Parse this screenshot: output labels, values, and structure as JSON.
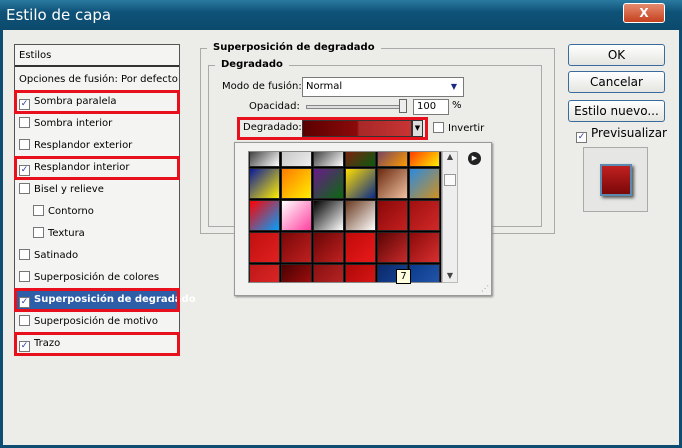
{
  "window": {
    "title": "Estilo de capa",
    "close": "X"
  },
  "styles_list": {
    "header": "Estilos",
    "items": [
      {
        "label": "Opciones de fusión: Por defecto",
        "checkbox": false,
        "checked": false
      },
      {
        "label": "Sombra paralela",
        "checkbox": true,
        "checked": true,
        "highlighted": true
      },
      {
        "label": "Sombra interior",
        "checkbox": true,
        "checked": false
      },
      {
        "label": "Resplandor exterior",
        "checkbox": true,
        "checked": false
      },
      {
        "label": "Resplandor interior",
        "checkbox": true,
        "checked": true,
        "highlighted": true
      },
      {
        "label": "Bisel y relieve",
        "checkbox": true,
        "checked": false
      },
      {
        "label": "Contorno",
        "checkbox": true,
        "checked": false,
        "sub": true
      },
      {
        "label": "Textura",
        "checkbox": true,
        "checked": false,
        "sub": true
      },
      {
        "label": "Satinado",
        "checkbox": true,
        "checked": false
      },
      {
        "label": "Superposición de colores",
        "checkbox": true,
        "checked": false
      },
      {
        "label": "Superposición de degradado",
        "checkbox": true,
        "checked": true,
        "selected": true,
        "highlighted": true
      },
      {
        "label": "Superposición de motivo",
        "checkbox": true,
        "checked": false
      },
      {
        "label": "Trazo",
        "checkbox": true,
        "checked": true,
        "highlighted": true
      }
    ]
  },
  "panel": {
    "title": "Superposición de degradado",
    "subtitle": "Degradado",
    "blend_mode_label": "Modo de fusión:",
    "blend_mode": "Normal",
    "opacity_label": "Opacidad:",
    "opacity": "100",
    "opacity_unit": "%",
    "gradient_label": "Degradado:",
    "invert_label": "Invertir",
    "tooltip": "7"
  },
  "buttons": {
    "ok": "OK",
    "cancel": "Cancelar",
    "new_style": "Estilo nuevo...",
    "preview": "Previsualizar"
  },
  "colors": {
    "highlight": "#e8101c",
    "selected": "#2e5ea8",
    "gradient_start": "#5a0000",
    "gradient_end": "#c83434"
  },
  "swatches": [
    [
      "#000",
      "#fff"
    ],
    [
      "#bbb",
      "#eee"
    ],
    [
      "#000",
      "#fff"
    ],
    [
      "#a01010",
      "#0a5a10"
    ],
    [
      "#4a2a80",
      "#ff9a00"
    ],
    [
      "#ff0000",
      "#ffee00"
    ],
    [
      "#0a1a9a",
      "#ffee00"
    ],
    [
      "#ff7a00",
      "#ffee00"
    ],
    [
      "#6a1a8a",
      "#0a6a10"
    ],
    [
      "#ffdd00",
      "#0a2a8a"
    ],
    [
      "#6a2a10",
      "#f0c0a0"
    ],
    [
      "#2a8ae0",
      "#d09020"
    ],
    [
      "#ff0000",
      "#00a0ff"
    ],
    [
      "#fff",
      "#ff40a0"
    ],
    [
      "#000",
      "#fff"
    ],
    [
      "#6a3a20",
      "#fff"
    ],
    [
      "#8a0808",
      "#c42020"
    ],
    [
      "#a01010",
      "#d02828"
    ],
    [
      "#c01010",
      "#e02020"
    ],
    [
      "#7a0808",
      "#c02020"
    ],
    [
      "#6a0606",
      "#c02020"
    ],
    [
      "#c00a0a",
      "#e81a1a"
    ],
    [
      "#5a0404",
      "#c82a2a"
    ],
    [
      "#8a0a0a",
      "#d83030"
    ],
    [
      "#c01818",
      "#e02828"
    ],
    [
      "#4a0202",
      "#b01010"
    ],
    [
      "#8a1010",
      "#c02828"
    ],
    [
      "#b00808",
      "#e01818"
    ],
    [
      "#0a2a6a",
      "#1a4aa0"
    ],
    [
      "#0a3a8a",
      "#2a5ab0"
    ]
  ]
}
